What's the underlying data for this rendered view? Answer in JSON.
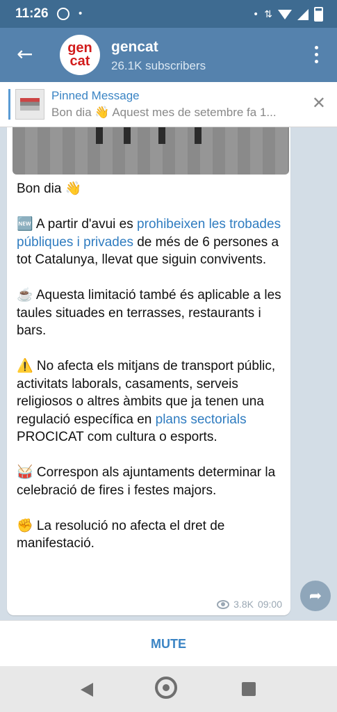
{
  "status_bar": {
    "time": "11:26",
    "whatsapp_icon": "whatsapp-icon",
    "dot": "•",
    "right_dot": "•"
  },
  "header": {
    "back_icon": "arrow-left-icon",
    "channel_name": "gencat",
    "subscribers": "26.1K subscribers",
    "avatar_line1": "gen",
    "avatar_line2": "cat",
    "menu_icon": "vertical-dots-icon"
  },
  "pinned": {
    "title": "Pinned Message",
    "text": "Bon dia 👋 Aquest mes de setembre fa 1...",
    "close": "✕"
  },
  "message": {
    "greeting": "Bon dia 👋",
    "p1_prefix": "🆕 A partir d'avui es ",
    "p1_link": "prohibeixen les trobades públiques i privades",
    "p1_suffix": " de més de 6 persones a tot Catalunya, llevat que siguin convivents.",
    "p2": "☕ Aquesta limitació també és aplicable a les taules situades en terrasses, restaurants i bars.",
    "p3_prefix": "⚠️ No afecta els mitjans de transport públic, activitats laborals, casaments, serveis religiosos o altres àmbits que ja tenen una regulació específica en ",
    "p3_link": "plans sectorials",
    "p3_suffix": " PROCICAT com cultura o esports.",
    "p4": "🥁 Correspon als ajuntaments determinar la celebració de fires i festes majors.",
    "p5": "✊ La resolució no afecta el dret de manifestació.",
    "views": "3.8K",
    "time": "09:00"
  },
  "share_icon": "share-arrow-icon",
  "footer": {
    "mute_label": "MUTE"
  },
  "nav": {
    "back": "nav-back-icon",
    "home": "nav-home-icon",
    "recent": "nav-recent-icon"
  },
  "colors": {
    "header": "#5582ad",
    "status": "#3e6b91",
    "link": "#2f7cc0",
    "chat_bg": "#d3dde6"
  }
}
